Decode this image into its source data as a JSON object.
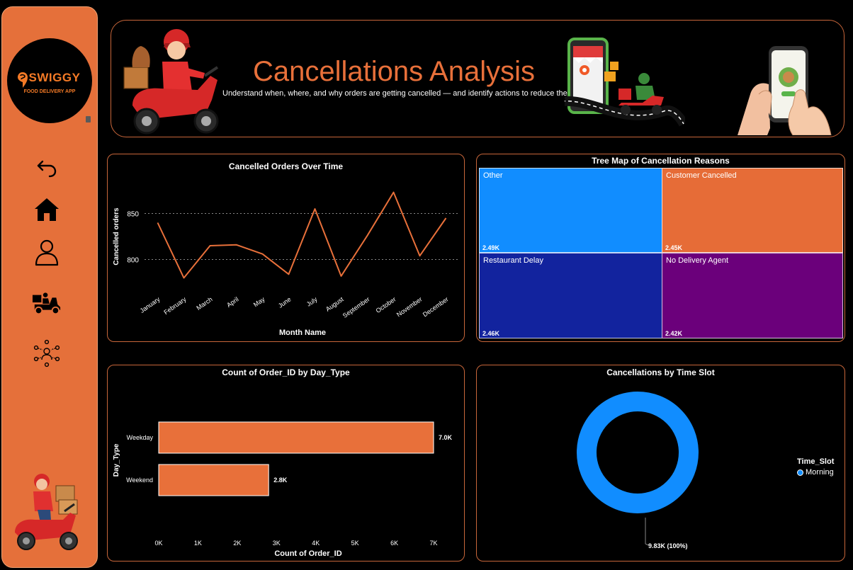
{
  "sidebar": {
    "logo": {
      "wordmark": "SWIGGY",
      "tagline": "FOOD DELIVERY APP"
    },
    "nav": [
      {
        "icon": "back-arrow-icon",
        "label": "Back"
      },
      {
        "icon": "home-icon",
        "label": "Home"
      },
      {
        "icon": "person-icon",
        "label": "Customers"
      },
      {
        "icon": "delivery-scooter-icon",
        "label": "Delivery"
      },
      {
        "icon": "network-people-icon",
        "label": "Partners"
      }
    ]
  },
  "header": {
    "title": "Cancellations Analysis",
    "subtitle": "Understand when, where, and why orders are getting cancelled — and identify actions to reduce them"
  },
  "colors": {
    "accent": "#e8703a",
    "line": "#e8703a",
    "bar": "#e8703a",
    "treemap_other": "#118dff",
    "treemap_customer": "#e66c37",
    "treemap_restaurant": "#12239e",
    "treemap_agent": "#6b007b",
    "donut": "#118dff"
  },
  "chart_data": [
    {
      "id": "line",
      "type": "line",
      "title": "Cancelled Orders Over Time",
      "xlabel": "Month Name",
      "ylabel": "Cancelled orders",
      "categories": [
        "January",
        "February",
        "March",
        "April",
        "May",
        "June",
        "July",
        "August",
        "September",
        "October",
        "November",
        "December"
      ],
      "values": [
        840,
        780,
        815,
        816,
        806,
        784,
        855,
        782,
        826,
        873,
        804,
        845
      ],
      "yticks": [
        800,
        850
      ],
      "ylim": [
        765,
        885
      ],
      "grid": true
    },
    {
      "id": "treemap",
      "type": "treemap",
      "title": "Tree Map of Cancellation Reasons",
      "items": [
        {
          "label": "Other",
          "value": "2.49K"
        },
        {
          "label": "Customer Cancelled",
          "value": "2.45K"
        },
        {
          "label": "Restaurant Delay",
          "value": "2.46K"
        },
        {
          "label": "No Delivery Agent",
          "value": "2.42K"
        }
      ]
    },
    {
      "id": "bar",
      "type": "bar",
      "orientation": "horizontal",
      "title": "Count of Order_ID by Day_Type",
      "xlabel": "Count of Order_ID",
      "ylabel": "Day_Type",
      "categories": [
        "Weekday",
        "Weekend"
      ],
      "values": [
        7000,
        2800
      ],
      "data_labels": [
        "7.0K",
        "2.8K"
      ],
      "xticks": [
        "0K",
        "1K",
        "2K",
        "3K",
        "4K",
        "5K",
        "6K",
        "7K"
      ],
      "xlim": [
        0,
        7000
      ]
    },
    {
      "id": "donut",
      "type": "pie",
      "style": "donut",
      "title": "Cancellations by Time Slot",
      "legend_title": "Time_Slot",
      "slices": [
        {
          "label": "Morning",
          "value": 9830,
          "data_label": "9.83K (100%)"
        }
      ],
      "legend": "right"
    }
  ]
}
